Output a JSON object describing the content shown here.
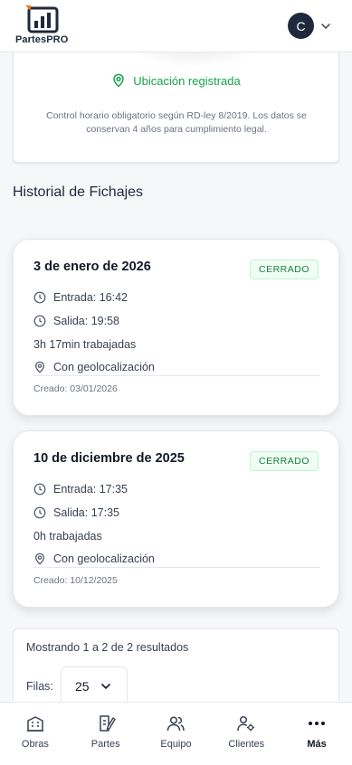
{
  "app": {
    "name": "PartesPRO",
    "user_initial": "C"
  },
  "location": {
    "status": "Ubicación registrada",
    "legal_note": "Control horario obligatorio según RD-ley 8/2019. Los datos se conservan 4 años para cumplimiento legal."
  },
  "history": {
    "title": "Historial de Fichajes",
    "records": [
      {
        "date": "3 de enero de 2026",
        "status": "CERRADO",
        "entrada": "Entrada: 16:42",
        "salida": "Salida: 19:58",
        "worked": "3h 17min trabajadas",
        "geo": "Con geolocalización",
        "created": "Creado: 03/01/2026"
      },
      {
        "date": "10 de diciembre de 2025",
        "status": "CERRADO",
        "entrada": "Entrada: 17:35",
        "salida": "Salida: 17:35",
        "worked": "0h trabajadas",
        "geo": "Con geolocalización",
        "created": "Creado: 10/12/2025"
      }
    ]
  },
  "pagination": {
    "summary": "Mostrando 1 a 2 de 2 resultados",
    "rows_label": "Filas:",
    "rows_value": "25"
  },
  "nav": {
    "items": [
      {
        "label": "Obras",
        "icon": "building-icon"
      },
      {
        "label": "Partes",
        "icon": "edit-document-icon"
      },
      {
        "label": "Equipo",
        "icon": "users-icon"
      },
      {
        "label": "Clientes",
        "icon": "user-gear-icon"
      },
      {
        "label": "Más",
        "icon": "more-dots-icon"
      }
    ],
    "active": "Más"
  },
  "colors": {
    "brand": "#1e293b",
    "success": "#16a34a",
    "badge_bg": "#f0fdf4"
  }
}
